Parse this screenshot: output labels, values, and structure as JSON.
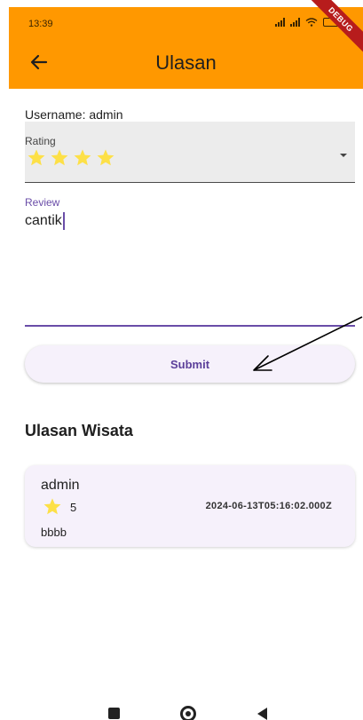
{
  "status_bar": {
    "time": "13:39",
    "debug_label": "DEBUG"
  },
  "app_bar": {
    "title": "Ulasan",
    "back_icon": "arrow-back-icon",
    "color": "#ff9800"
  },
  "form": {
    "username_text": "Username: admin",
    "rating": {
      "label": "Rating",
      "stars_selected": 4,
      "star_icon": "star-icon",
      "star_color": "#fde047"
    },
    "review": {
      "label": "Review",
      "value": "cantik"
    },
    "submit_label": "Submit"
  },
  "reviews_section": {
    "title": "Ulasan Wisata",
    "items": [
      {
        "username": "admin",
        "rating": "5",
        "date": "2024-06-13T05:16:02.000Z",
        "text": "bbbb"
      }
    ]
  },
  "colors": {
    "accent": "#6a4da8",
    "card_bg": "#f6f1fb"
  }
}
